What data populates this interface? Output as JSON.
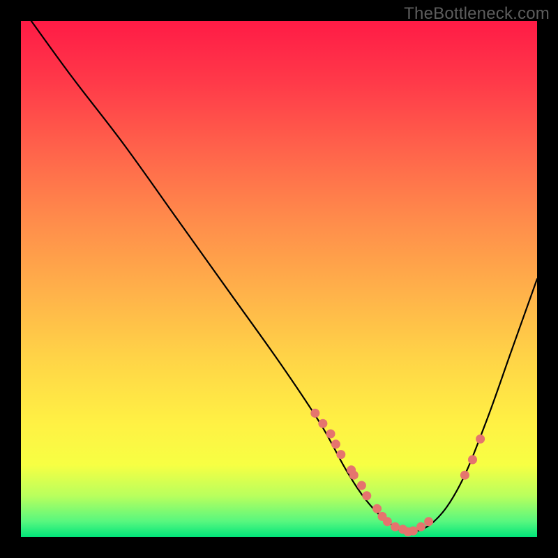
{
  "watermark": {
    "text": "TheBottleneck.com"
  },
  "chart_data": {
    "type": "line",
    "title": "",
    "xlabel": "",
    "ylabel": "",
    "xlim": [
      0,
      100
    ],
    "ylim": [
      0,
      100
    ],
    "series": [
      {
        "name": "curve",
        "x": [
          2,
          10,
          20,
          30,
          40,
          50,
          58,
          63,
          67,
          71,
          75,
          80,
          85,
          90,
          95,
          100
        ],
        "y": [
          100,
          89,
          76,
          62,
          48,
          34,
          22,
          13,
          7,
          3,
          1,
          3,
          10,
          22,
          36,
          50
        ]
      }
    ],
    "markers": {
      "name": "highlight-points",
      "x": [
        57,
        58.5,
        60,
        61,
        62,
        64,
        64.5,
        66,
        67,
        69,
        70,
        71,
        72.5,
        74,
        75,
        76,
        77.5,
        79,
        86,
        87.5,
        89
      ],
      "y": [
        24,
        22,
        20,
        18,
        16,
        13,
        12,
        10,
        8,
        5.5,
        4,
        3,
        2,
        1.5,
        1,
        1.2,
        2,
        3,
        12,
        15,
        19
      ]
    },
    "background": {
      "gradient_stops": [
        {
          "offset": 0.0,
          "color": "#ff1b46"
        },
        {
          "offset": 0.25,
          "color": "#ff634b"
        },
        {
          "offset": 0.52,
          "color": "#ffb04a"
        },
        {
          "offset": 0.78,
          "color": "#fff144"
        },
        {
          "offset": 0.92,
          "color": "#b9ff5d"
        },
        {
          "offset": 1.0,
          "color": "#00e57a"
        }
      ]
    }
  }
}
